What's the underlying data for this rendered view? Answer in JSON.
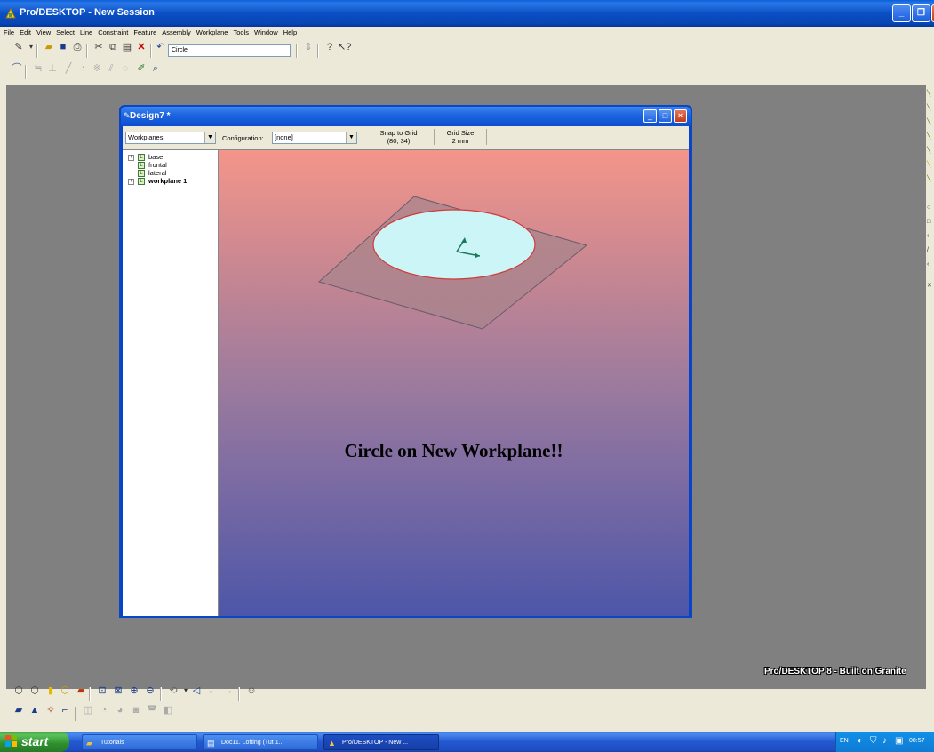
{
  "window": {
    "title": "Pro/DESKTOP - New Session",
    "minimize": "_",
    "maximize": "❐",
    "close": "✕"
  },
  "menu": [
    "File",
    "Edit",
    "View",
    "Select",
    "Line",
    "Constraint",
    "Feature",
    "Assembly",
    "Workplane",
    "Tools",
    "Window",
    "Help"
  ],
  "toolbar": {
    "command_combo": "Circle"
  },
  "branding": "Pro/DESKTOP 8 - Built on Granite",
  "design_window": {
    "title": "Design7 *",
    "browser_select": "Workplanes",
    "configuration_label": "Configuration:",
    "configuration_value": "[none]",
    "snap_label": "Snap to Grid",
    "snap_value": "(80, 34)",
    "grid_label": "Grid Size",
    "grid_value": "2 mm",
    "tree": [
      {
        "label": "base",
        "expandable": true,
        "bold": false
      },
      {
        "label": "frontal",
        "expandable": false,
        "bold": false
      },
      {
        "label": "lateral",
        "expandable": false,
        "bold": false
      },
      {
        "label": "workplane 1",
        "expandable": true,
        "bold": true
      }
    ],
    "viewport_caption": "Circle on New Workplane!!"
  },
  "colors": {
    "viewport_top": "#f4958a",
    "viewport_bottom": "#4d56a8",
    "plane_fill": "#a8848c",
    "circle_fill": "#ccf5f8",
    "circle_edge": "#d23a3a",
    "axis": "#1a7a5a"
  },
  "taskbar": {
    "start": "start",
    "tasks": [
      "Tutorials",
      "Doc11. Lofting (Tut 1...",
      "Pro/DESKTOP - New ..."
    ],
    "lang": "EN",
    "clock": "08:57"
  }
}
